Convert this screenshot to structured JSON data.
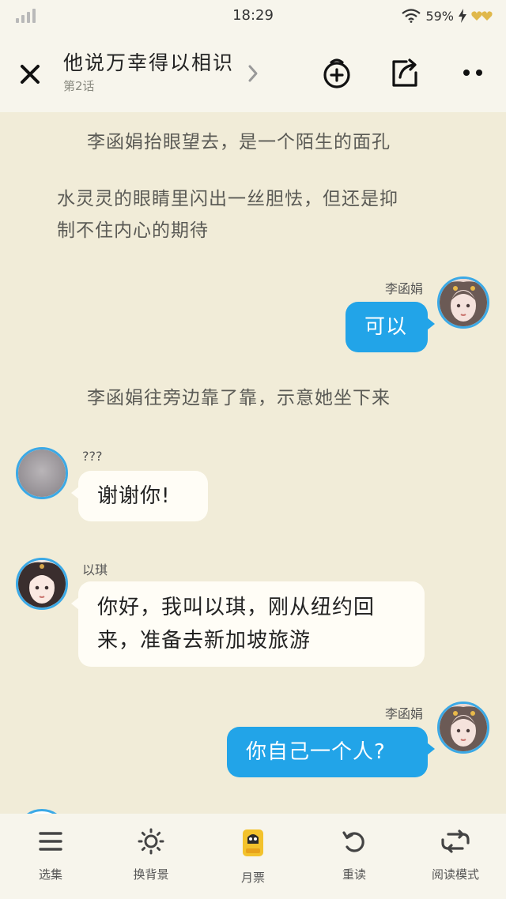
{
  "status_bar": {
    "time": "18:29",
    "battery": "59%"
  },
  "header": {
    "title": "他说万幸得以相识",
    "episode": "第2话"
  },
  "messages": [
    {
      "type": "narration",
      "lines": [
        "李函娟抬眼望去，是一个陌生的面孔"
      ]
    },
    {
      "type": "narration",
      "lines": [
        "水灵灵的眼睛里闪出一丝胆怯，但还是抑",
        "制不住内心的期待"
      ]
    },
    {
      "type": "dialogue",
      "side": "right",
      "speaker": "李函娟",
      "lines": [
        "可以"
      ]
    },
    {
      "type": "narration",
      "lines": [
        "李函娟往旁边靠了靠，示意她坐下来"
      ]
    },
    {
      "type": "dialogue",
      "side": "left",
      "speaker": "???",
      "lines": [
        "谢谢你!"
      ]
    },
    {
      "type": "dialogue",
      "side": "left",
      "speaker": "以琪",
      "lines": [
        "你好，我叫以琪，刚从纽约回",
        "来，准备去新加坡旅游"
      ]
    },
    {
      "type": "dialogue",
      "side": "right",
      "speaker": "李函娟",
      "lines": [
        "你自己一个人?"
      ]
    }
  ],
  "bottom_bar": {
    "items": [
      {
        "label": "选集",
        "icon": "menu-icon"
      },
      {
        "label": "换背景",
        "icon": "sun-icon"
      },
      {
        "label": "月票",
        "icon": "monthly-ticket-icon"
      },
      {
        "label": "重读",
        "icon": "reread-icon"
      },
      {
        "label": "阅读模式",
        "icon": "read-mode-icon"
      }
    ]
  },
  "colors": {
    "background": "#f1ecd8",
    "bar_background": "#f7f5ec",
    "bubble_blue": "#22a4e8",
    "bubble_white": "#fffdf6",
    "avatar_border": "#3ba9e6"
  }
}
